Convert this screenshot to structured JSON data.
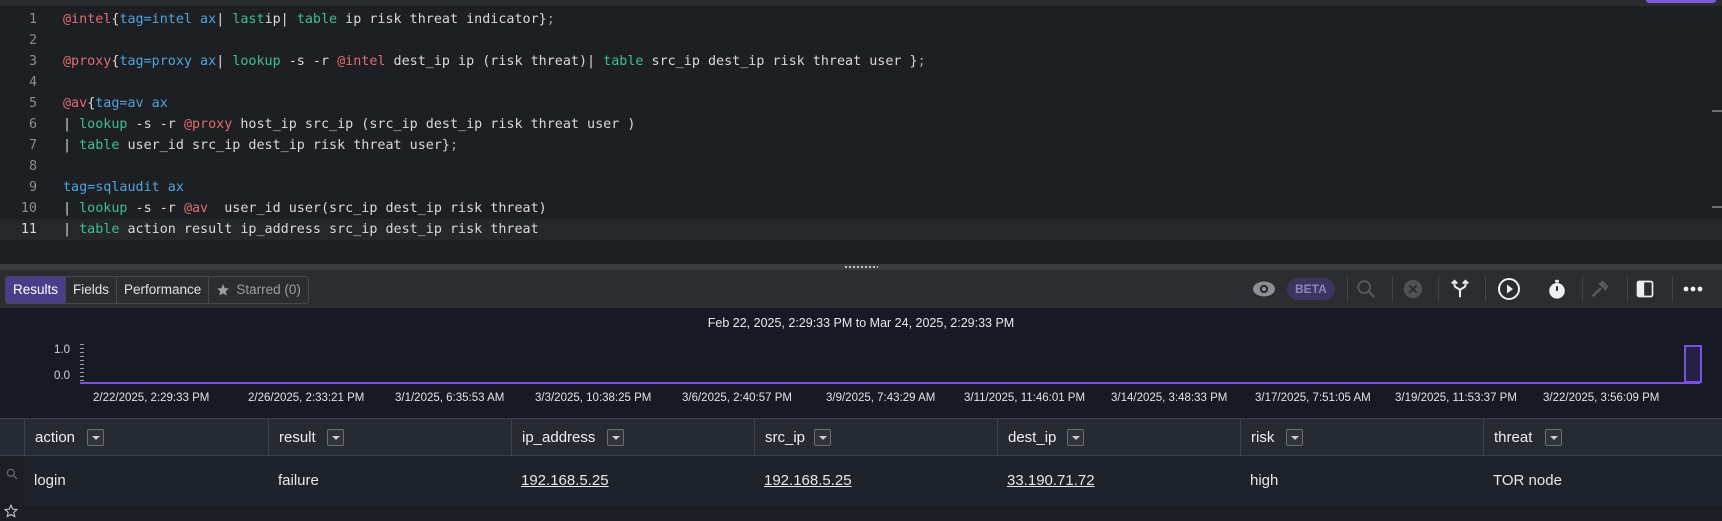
{
  "editor": {
    "lines": [
      {
        "n": "1",
        "tokens": [
          [
            "t-macro",
            "@intel"
          ],
          [
            "t-pipe",
            "{"
          ],
          [
            "t-tag",
            "tag=intel ax"
          ],
          [
            "t-pipe",
            "| "
          ],
          [
            "t-kw",
            "last"
          ],
          [
            "",
            "ip| "
          ],
          [
            "t-kw",
            "table"
          ],
          [
            "",
            " ip risk threat indicator}"
          ],
          [
            "t-dim",
            ";"
          ]
        ]
      },
      {
        "n": "2",
        "tokens": []
      },
      {
        "n": "3",
        "tokens": [
          [
            "t-macro",
            "@proxy"
          ],
          [
            "t-pipe",
            "{"
          ],
          [
            "t-tag",
            "tag=proxy ax"
          ],
          [
            "t-pipe",
            "| "
          ],
          [
            "t-kw",
            "lookup"
          ],
          [
            "",
            " -s -r "
          ],
          [
            "t-macro",
            "@intel"
          ],
          [
            "",
            " dest_ip ip (risk threat)| "
          ],
          [
            "t-kw",
            "table"
          ],
          [
            "",
            " src_ip dest_ip risk threat user }"
          ],
          [
            "t-dim",
            ";"
          ]
        ]
      },
      {
        "n": "4",
        "tokens": []
      },
      {
        "n": "5",
        "tokens": [
          [
            "t-macro",
            "@av"
          ],
          [
            "t-pipe",
            "{"
          ],
          [
            "t-tag",
            "tag=av ax"
          ]
        ]
      },
      {
        "n": "6",
        "tokens": [
          [
            "",
            "| "
          ],
          [
            "t-kw",
            "lookup"
          ],
          [
            "",
            " -s -r "
          ],
          [
            "t-macro",
            "@proxy"
          ],
          [
            "",
            " host_ip src_ip (src_ip dest_ip risk threat user )"
          ]
        ]
      },
      {
        "n": "7",
        "tokens": [
          [
            "",
            "| "
          ],
          [
            "t-kw",
            "table"
          ],
          [
            "",
            " user_id src_ip dest_ip risk threat user}"
          ],
          [
            "t-dim",
            ";"
          ]
        ]
      },
      {
        "n": "8",
        "tokens": []
      },
      {
        "n": "9",
        "tokens": [
          [
            "t-tag",
            "tag=sqlaudit ax"
          ]
        ]
      },
      {
        "n": "10",
        "tokens": [
          [
            "",
            "| "
          ],
          [
            "t-kw",
            "lookup"
          ],
          [
            "",
            " -s -r "
          ],
          [
            "t-macro",
            "@av"
          ],
          [
            "",
            "  user_id user(src_ip dest_ip risk threat)"
          ]
        ]
      },
      {
        "n": "11",
        "tokens": [
          [
            "",
            "| "
          ],
          [
            "t-kw",
            "table"
          ],
          [
            "",
            " action result ip_address src_ip dest_ip risk threat"
          ]
        ]
      }
    ]
  },
  "toolbar": {
    "tabs": {
      "results": "Results",
      "fields": "Fields",
      "performance": "Performance",
      "starred": "Starred (0)"
    },
    "beta": "BETA"
  },
  "histogram": {
    "range": "Feb 22, 2025, 2:29:33 PM to Mar 24, 2025, 2:29:33 PM",
    "y_ticks": [
      "1.0",
      "0.0"
    ],
    "x_labels": [
      "2/22/2025, 2:29:33 PM",
      "2/26/2025, 2:33:21 PM",
      "3/1/2025, 6:35:53 AM",
      "3/3/2025, 10:38:25 PM",
      "3/6/2025, 2:40:57 PM",
      "3/9/2025, 7:43:29 AM",
      "3/11/2025, 11:46:01 PM",
      "3/14/2025, 3:48:33 PM",
      "3/17/2025, 7:51:05 AM",
      "3/19/2025, 11:53:37 PM",
      "3/22/2025, 3:56:09 PM"
    ],
    "accent": "#7a52e0"
  },
  "table": {
    "columns": [
      "action",
      "result",
      "ip_address",
      "src_ip",
      "dest_ip",
      "risk",
      "threat"
    ],
    "rows": [
      {
        "action": "login",
        "result": "failure",
        "ip_address": "192.168.5.25",
        "src_ip": "192.168.5.25",
        "dest_ip": "33.190.71.72",
        "risk": "high",
        "threat": "TOR node"
      }
    ]
  }
}
